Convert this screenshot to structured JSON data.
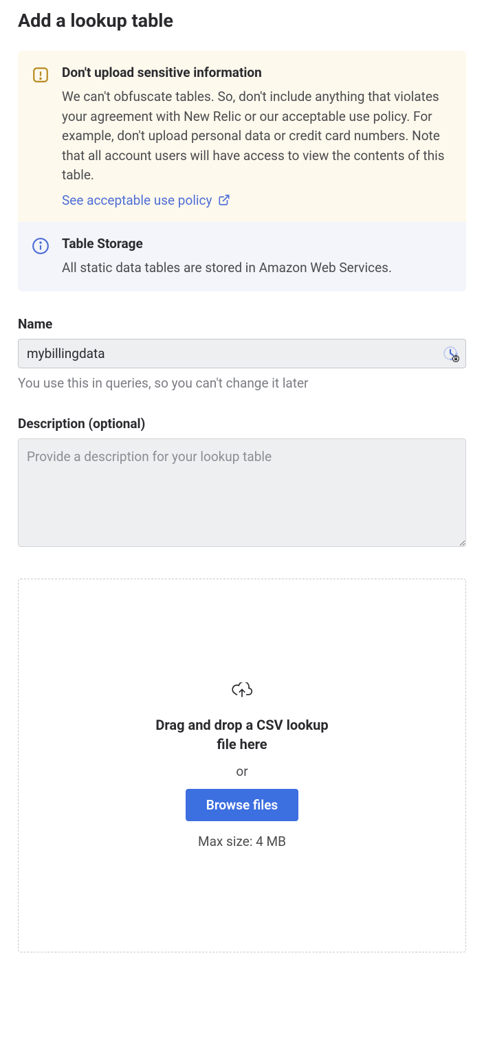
{
  "page": {
    "title": "Add a lookup table"
  },
  "alerts": {
    "warning": {
      "title": "Don't upload sensitive information",
      "text": "We can't obfuscate tables. So, don't include anything that violates your agreement with New Relic or our acceptable use policy. For example, don't upload personal data or credit card numbers. Note that all account users will have access to view the contents of this table.",
      "link_label": "See acceptable use policy"
    },
    "info": {
      "title": "Table Storage",
      "text": "All static data tables are stored in Amazon Web Services."
    }
  },
  "form": {
    "name": {
      "label": "Name",
      "value": "mybillingdata",
      "helper": "You use this in queries, so you can't change it later"
    },
    "description": {
      "label": "Description (optional)",
      "placeholder": "Provide a description for your lookup table"
    }
  },
  "dropzone": {
    "title": "Drag and drop a CSV lookup file here",
    "or": "or",
    "browse_label": "Browse files",
    "max_size": "Max size: 4 MB"
  }
}
